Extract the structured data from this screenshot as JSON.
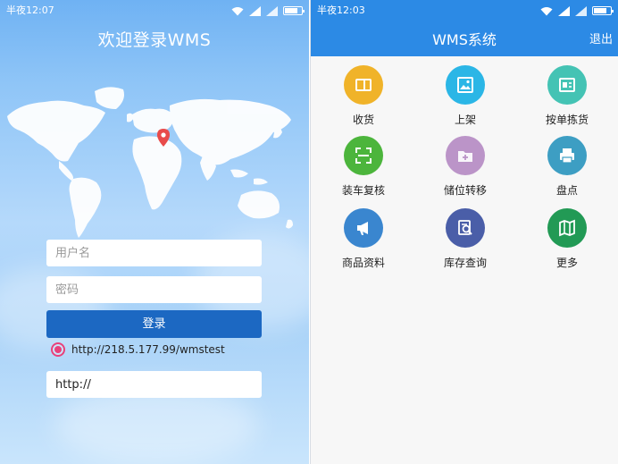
{
  "left": {
    "status_time": "半夜12:07",
    "title": "欢迎登录WMS",
    "username_placeholder": "用户名",
    "password_placeholder": "密码",
    "login_label": "登录",
    "server_url": "http://218.5.177.99/wmstest",
    "server_input_value": "http://"
  },
  "right": {
    "status_time": "半夜12:03",
    "title": "WMS系统",
    "logout_label": "退出",
    "menu": [
      {
        "label": "收货",
        "icon": "receive-icon",
        "color": "#f0b329"
      },
      {
        "label": "上架",
        "icon": "image-icon",
        "color": "#2bb6e6"
      },
      {
        "label": "按单拣货",
        "icon": "document-icon",
        "color": "#44c3b4"
      },
      {
        "label": "装车复核",
        "icon": "scan-icon",
        "color": "#4cb53c"
      },
      {
        "label": "储位转移",
        "icon": "folder-add-icon",
        "color": "#bb94c8"
      },
      {
        "label": "盘点",
        "icon": "printer-icon",
        "color": "#3d9ec3"
      },
      {
        "label": "商品资料",
        "icon": "megaphone-icon",
        "color": "#3a86cf"
      },
      {
        "label": "库存查询",
        "icon": "search-doc-icon",
        "color": "#4a5ea8"
      },
      {
        "label": "更多",
        "icon": "map-icon",
        "color": "#229a55"
      }
    ]
  },
  "colors": {
    "login_button": "#1c68c2",
    "header": "#2c8ae5",
    "radio": "#e8417b",
    "map_pin": "#e84b4b"
  }
}
